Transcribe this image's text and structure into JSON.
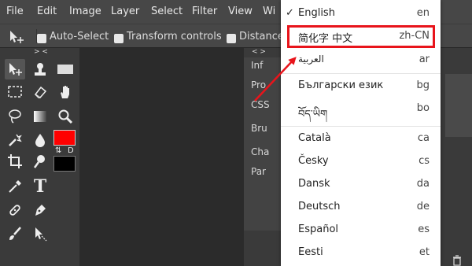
{
  "menubar": {
    "items": [
      "File",
      "Edit",
      "Image",
      "Layer",
      "Select",
      "Filter",
      "View",
      "Wi"
    ]
  },
  "optionsbar": {
    "auto_select": "Auto-Select",
    "transform_controls": "Transform controls",
    "distances": "Distances"
  },
  "tools_panel": {
    "collapse_label": "> <",
    "text_tool_glyph": "T",
    "swap_glyph": "⇅",
    "default_glyph": "D"
  },
  "middle_panel": {
    "collapse_label": "< >",
    "tabs": [
      "Inf",
      "Pro",
      "CSS",
      "Bru",
      "Cha",
      "Par"
    ]
  },
  "colors": {
    "foreground": "#ff0000",
    "background": "#000000",
    "highlight": "#e8141b"
  },
  "language_menu": {
    "check_mark": "✓",
    "items": [
      {
        "name": "English",
        "code": "en"
      },
      {
        "name": "简化字 中文",
        "code": "zh-CN"
      },
      {
        "name": "العربية",
        "code": "ar"
      },
      {
        "name": "Български език",
        "code": "bg"
      },
      {
        "name": "བོད་ཡིག",
        "code": "bo"
      },
      {
        "name": "Català",
        "code": "ca"
      },
      {
        "name": "Česky",
        "code": "cs"
      },
      {
        "name": "Dansk",
        "code": "da"
      },
      {
        "name": "Deutsch",
        "code": "de"
      },
      {
        "name": "Español",
        "code": "es"
      },
      {
        "name": "Eesti",
        "code": "et"
      }
    ]
  }
}
